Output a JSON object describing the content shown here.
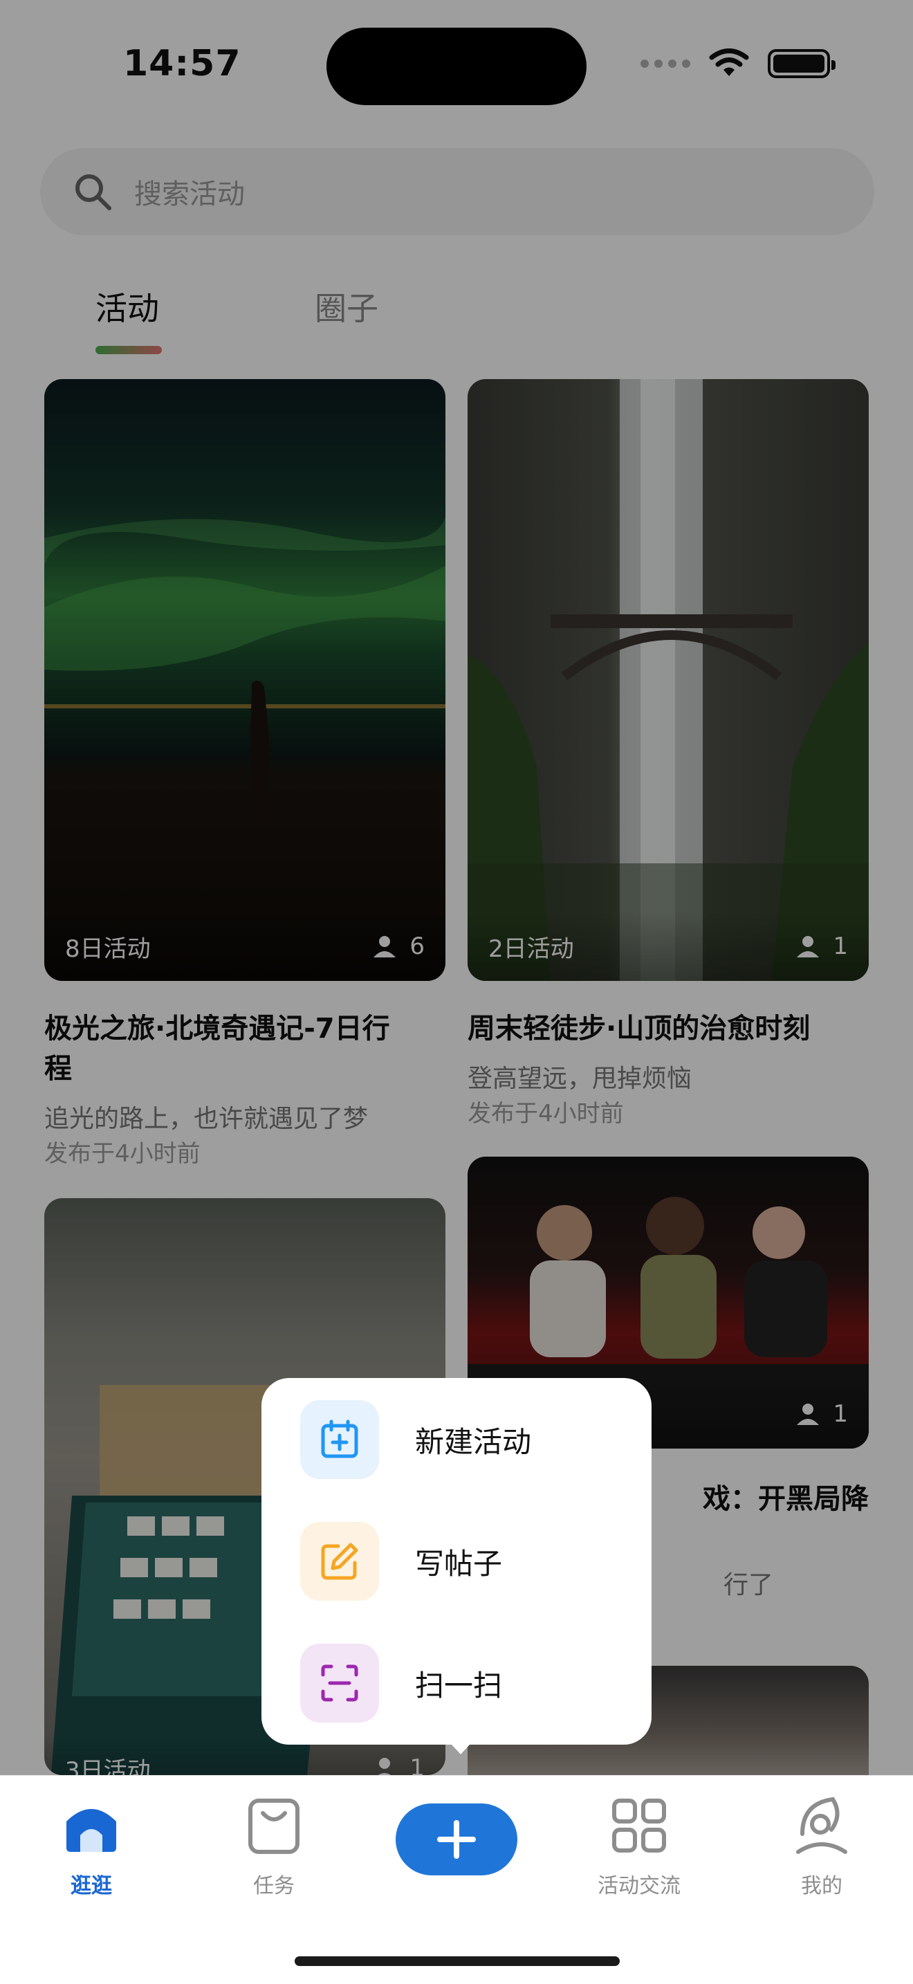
{
  "status_bar": {
    "time": "14:57"
  },
  "search": {
    "placeholder": "搜索活动"
  },
  "tabs": [
    {
      "label": "活动",
      "active": true
    },
    {
      "label": "圈子",
      "active": false
    }
  ],
  "feed": [
    {
      "badge": "8日活动",
      "participants": "6",
      "title": "极光之旅·北境奇遇记-7日行程",
      "title_line1": "极光之旅·北境奇遇记-7日行",
      "title_line2": "程",
      "subtitle": "追光的路上，也许就遇见了梦",
      "time": "发布于4小时前"
    },
    {
      "badge": "2日活动",
      "participants": "1",
      "title": "周末轻徒步·山顶的治愈时刻",
      "subtitle": "登高望远，甩掉烦恼",
      "time": "发布于4小时前"
    },
    {
      "badge": "3日活动",
      "participants": "1"
    },
    {
      "participants": "1",
      "title_fragment": "戏：开黑局降",
      "subtitle_fragment": "行了"
    }
  ],
  "popup_menu": {
    "items": [
      {
        "label": "新建活动",
        "icon": "calendar-plus-icon",
        "color": "#2196f3",
        "bg": "#e6f2fd"
      },
      {
        "label": "写帖子",
        "icon": "edit-icon",
        "color": "#f5a623",
        "bg": "#fef3e2"
      },
      {
        "label": "扫一扫",
        "icon": "scan-icon",
        "color": "#9c27b0",
        "bg": "#f3e5f5"
      }
    ]
  },
  "bottom_nav": {
    "items": [
      {
        "label": "逛逛",
        "icon": "home-icon",
        "active": true
      },
      {
        "label": "任务",
        "icon": "bag-icon",
        "active": false
      },
      {
        "label": "活动交流",
        "icon": "grid-icon",
        "active": false
      },
      {
        "label": "我的",
        "icon": "profile-icon",
        "active": false
      }
    ],
    "plus_icon": "plus-icon"
  },
  "colors": {
    "accent": "#1f76d8",
    "active_nav": "#1967d2"
  }
}
